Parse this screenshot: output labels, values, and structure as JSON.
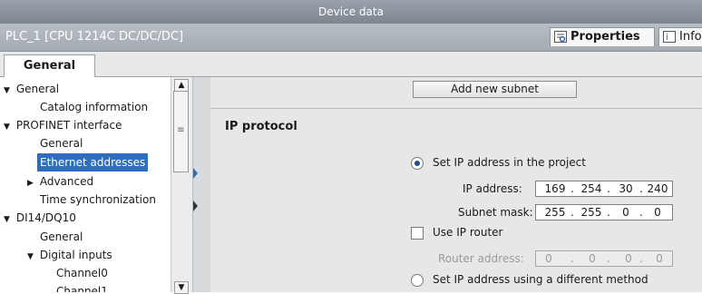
{
  "topbar": {
    "title": "Device data"
  },
  "object": {
    "title": "PLC_1 [CPU 1214C DC/DC/DC]",
    "tabs": {
      "properties": "Properties",
      "info": "Info"
    }
  },
  "tabs": {
    "general": "General"
  },
  "tree": {
    "items": [
      {
        "label": "General",
        "arrow": "▼"
      },
      {
        "label": "Catalog information"
      },
      {
        "label": "PROFINET interface",
        "arrow": "▼"
      },
      {
        "label": "General"
      },
      {
        "label": "Ethernet addresses",
        "selected": true
      },
      {
        "label": "Advanced",
        "arrow": "▶"
      },
      {
        "label": "Time synchronization"
      },
      {
        "label": "DI14/DQ10",
        "arrow": "▼"
      },
      {
        "label": "General"
      },
      {
        "label": "Digital inputs",
        "arrow": "▼"
      },
      {
        "label": "Channel0"
      },
      {
        "label": "Channel1"
      }
    ]
  },
  "panel": {
    "add_subnet": "Add new subnet",
    "heading": "IP protocol",
    "set_ip_project": "Set IP address in the project",
    "ip_label": "IP address:",
    "ip": [
      "169",
      "254",
      "30",
      "240"
    ],
    "mask_label": "Subnet mask:",
    "mask": [
      "255",
      "255",
      "0",
      "0"
    ],
    "use_router": "Use IP router",
    "router_label": "Router address:",
    "router": [
      "0",
      "0",
      "0",
      "0"
    ],
    "set_ip_other": "Set IP address using a different method",
    "dot": "."
  },
  "colors": {
    "selection": "#2d6fbe",
    "accent_blue": "#1f4f8f"
  },
  "icons": {
    "properties": "properties-icon",
    "info": "info-icon"
  }
}
